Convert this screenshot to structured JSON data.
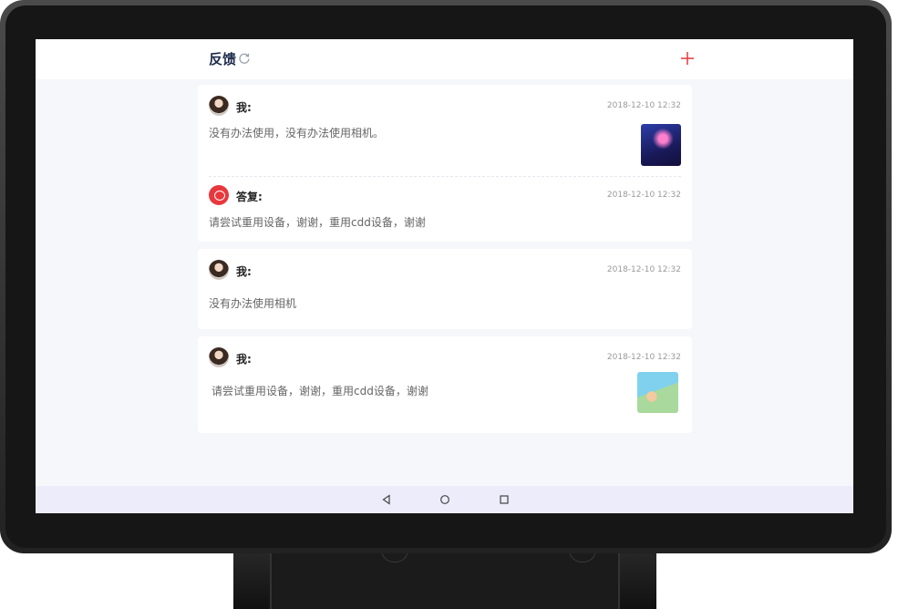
{
  "header": {
    "title": "反馈",
    "refresh_icon": "refresh-icon",
    "add_icon": "plus-icon",
    "accent": "#e8383d"
  },
  "feedback": [
    {
      "message": {
        "sender": "我:",
        "time": "2018-12-10 12:32",
        "text": "没有办法使用，没有办法使用相机。",
        "has_image": true
      },
      "reply": {
        "sender": "答复:",
        "time": "2018-12-10 12:32",
        "text": "请尝试重用设备，谢谢，重用cdd设备，谢谢"
      }
    },
    {
      "message": {
        "sender": "我:",
        "time": "2018-12-10 12:32",
        "text": "没有办法使用相机",
        "has_image": false
      }
    },
    {
      "message": {
        "sender": "我:",
        "time": "2018-12-10 12:32",
        "text": "请尝试重用设备，谢谢，重用cdd设备，谢谢",
        "has_image": true
      }
    }
  ],
  "navbar": {
    "icons": [
      "back-icon",
      "home-icon",
      "recents-icon"
    ]
  }
}
